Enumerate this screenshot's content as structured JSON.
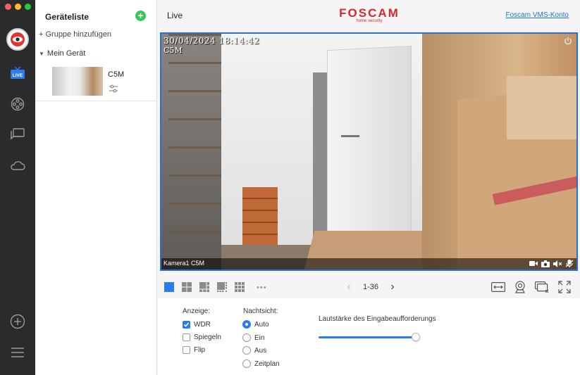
{
  "leftbar": {
    "items": [
      {
        "name": "avatar"
      },
      {
        "name": "live-icon",
        "label": "LIVE"
      },
      {
        "name": "playback-icon"
      },
      {
        "name": "messages-icon"
      },
      {
        "name": "cloud-icon"
      }
    ],
    "bottom": [
      {
        "name": "add-icon"
      },
      {
        "name": "menu-icon"
      }
    ]
  },
  "device_list": {
    "title": "Geräteliste",
    "add_group": "+ Gruppe hinzufügen",
    "group_name": "Mein Gerät",
    "device": {
      "name": "C5M"
    }
  },
  "header": {
    "title": "Live",
    "logo": "FOSCAM",
    "logo_sub": "home security",
    "vms_link": "Foscam VMS-Konto"
  },
  "video": {
    "timestamp": "30/04/2024 18:14:42",
    "cam_overlay": "C5M",
    "cam_label": "Kamera1 C5M"
  },
  "toolbar": {
    "pager": "1-36",
    "more": "•••"
  },
  "settings": {
    "display_head": "Anzeige:",
    "display_options": [
      {
        "label": "WDR",
        "checked": true
      },
      {
        "label": "Spiegeln",
        "checked": false
      },
      {
        "label": "Flip",
        "checked": false
      }
    ],
    "night_head": "Nachtsicht:",
    "night_options": [
      {
        "label": "Auto",
        "selected": true
      },
      {
        "label": "Ein",
        "selected": false
      },
      {
        "label": "Aus",
        "selected": false
      },
      {
        "label": "Zeitplan",
        "selected": false
      }
    ],
    "volume_label": "Lautstärke des Eingabeaufforderungs",
    "volume_level": 1.0
  },
  "colors": {
    "accent": "#2d7bf0",
    "brand": "#d8282f",
    "sidebar": "#2b2b2d"
  }
}
